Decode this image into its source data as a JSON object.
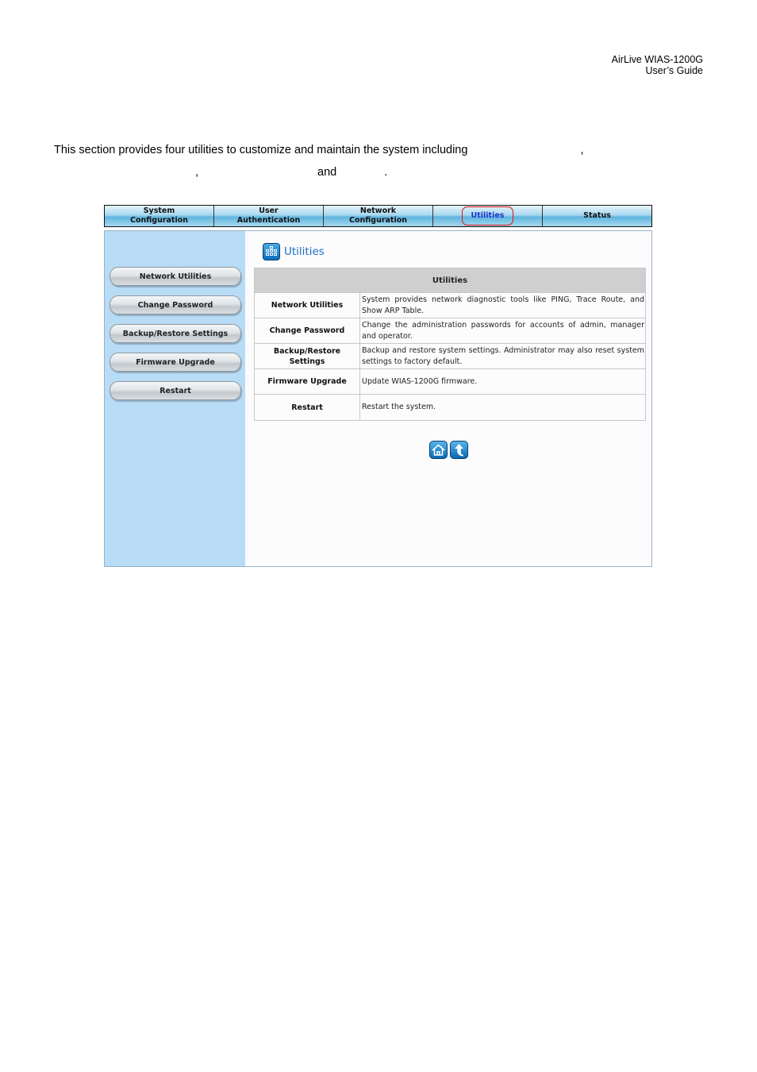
{
  "header": {
    "product": "AirLive  WIAS-1200G",
    "doc": "User’s  Guide"
  },
  "intro": {
    "line1": "This section provides four utilities to customize and maintain the system including",
    "comma1": ",",
    "comma2": ",",
    "and": "and",
    "period": "."
  },
  "nav": {
    "tabs": [
      {
        "line1": "System",
        "line2": "Configuration"
      },
      {
        "line1": "User",
        "line2": "Authentication"
      },
      {
        "line1": "Network",
        "line2": "Configuration"
      },
      {
        "line1": "Utilities",
        "line2": ""
      },
      {
        "line1": "Status",
        "line2": ""
      }
    ],
    "active": "Utilities"
  },
  "sidebar": {
    "buttons": [
      "Network Utilities",
      "Change Password",
      "Backup/Restore Settings",
      "Firmware Upgrade",
      "Restart"
    ]
  },
  "main": {
    "title": "Utilities",
    "table": {
      "header": "Utilities",
      "rows": [
        {
          "name": "Network Utilities",
          "desc": "System provides network diagnostic tools like PING, Trace Route, and Show ARP Table."
        },
        {
          "name": "Change Password",
          "desc": "Change the administration passwords for accounts of admin, manager and operator."
        },
        {
          "name": "Backup/Restore Settings",
          "desc": "Backup and restore system settings. Administrator may also reset system settings to factory default."
        },
        {
          "name": "Firmware Upgrade",
          "desc": "Update WIAS-1200G firmware."
        },
        {
          "name": "Restart",
          "desc": "Restart the system."
        }
      ]
    },
    "icons": [
      "home-icon",
      "up-arrow-icon"
    ]
  },
  "colors": {
    "accent": "#1a6fc4",
    "sidebar_bg": "#b9dcf6",
    "active_tab_text": "#1a35c8",
    "highlight": "#e01010"
  }
}
